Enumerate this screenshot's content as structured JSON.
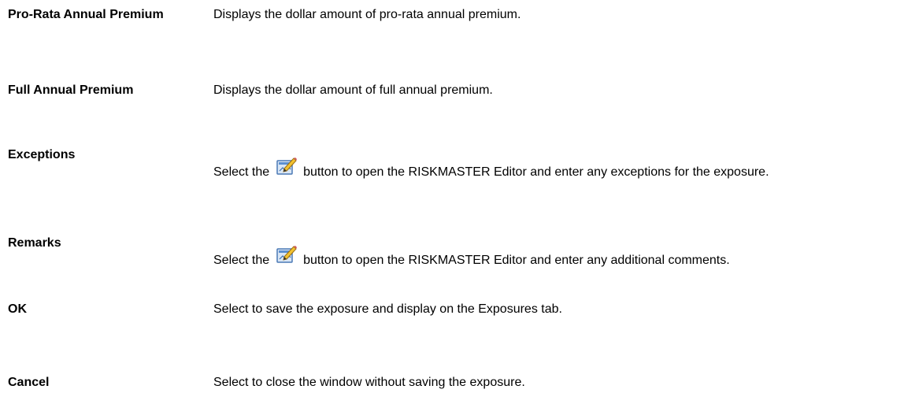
{
  "rows": [
    {
      "term": "Pro-Rata Annual Premium",
      "description": "Displays the dollar amount of pro-rata annual premium."
    },
    {
      "term": "Full Annual Premium",
      "description": "Displays the dollar amount of full annual premium."
    },
    {
      "term": "Exceptions",
      "description_before": "Select the",
      "icon": "editor-icon",
      "description_after": "button to open the RISKMASTER Editor and enter any exceptions for the exposure."
    },
    {
      "term": "Remarks",
      "description_before": "Select the",
      "icon": "editor-icon",
      "description_after": "button to open the RISKMASTER Editor and enter any additional comments."
    },
    {
      "term": "OK",
      "description": "Select to save the exposure and display on the Exposures tab."
    },
    {
      "term": "Cancel",
      "description": "Select to close the window without saving the exposure."
    }
  ]
}
